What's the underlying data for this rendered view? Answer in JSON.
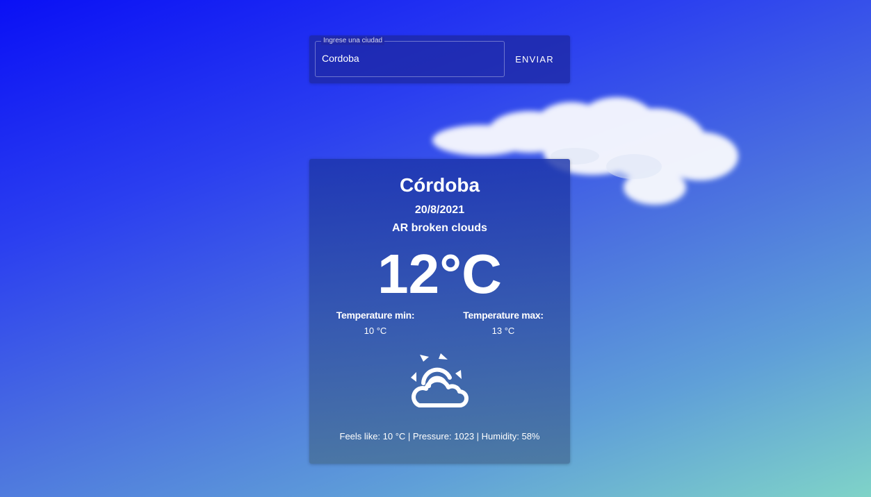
{
  "search": {
    "label": "Ingrese una ciudad",
    "value": "Cordoba",
    "button_label": "ENVIAR"
  },
  "weather": {
    "city": "Córdoba",
    "date": "20/8/2021",
    "description": "AR broken clouds",
    "temperature": "12°C",
    "min_label": "Temperature min:",
    "min_value": "10 °C",
    "max_label": "Temperature max:",
    "max_value": "13 °C",
    "icon": "sun-behind-cloud-icon",
    "stats": "Feels like: 10 °C | Pressure: 1023 | Humidity: 58%"
  },
  "colors": {
    "background_top": "#0a10f5",
    "background_bottom": "#7fd3c8",
    "text": "#ffffff"
  }
}
